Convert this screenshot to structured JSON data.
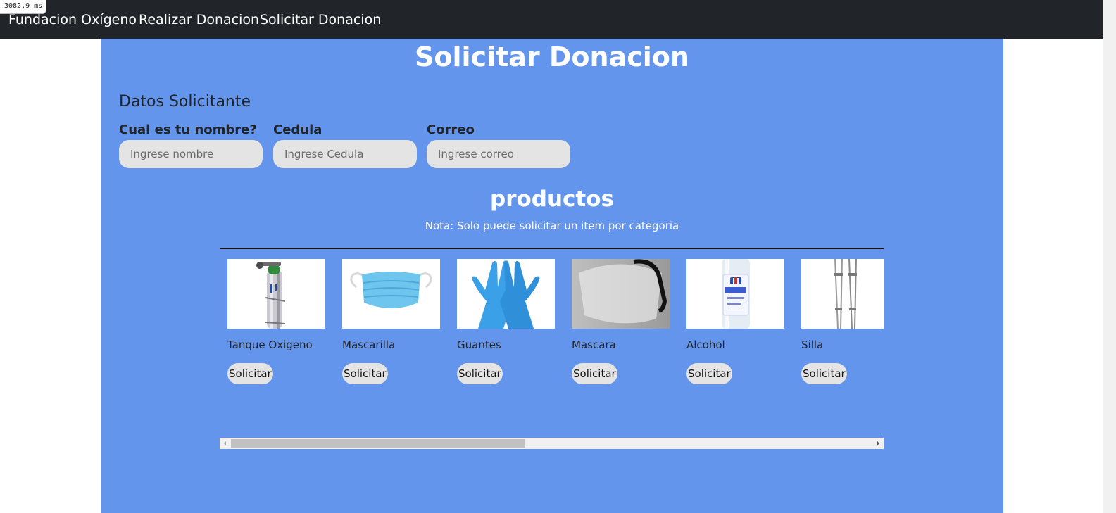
{
  "perf_badge": "3082.9 ms",
  "navbar": {
    "brand": "Fundacion Oxígeno",
    "links": [
      "Realizar Donacion",
      "Solicitar Donacion"
    ]
  },
  "page": {
    "title": "Solicitar Donacion",
    "section_title": "Datos Solicitante"
  },
  "form": {
    "name_label": "Cual es tu nombre?",
    "name_placeholder": "Ingrese nombre",
    "cedula_label": "Cedula",
    "cedula_placeholder": "Ingrese Cedula",
    "email_label": "Correo",
    "email_placeholder": "Ingrese correo"
  },
  "products": {
    "title": "productos",
    "note": "Nota: Solo puede solicitar un item por categoria",
    "request_label": "Solicitar",
    "items": [
      {
        "name": "Tanque Oxigeno",
        "icon": "oxygen-tank-image"
      },
      {
        "name": "Mascarilla",
        "icon": "face-mask-image"
      },
      {
        "name": "Guantes",
        "icon": "gloves-image"
      },
      {
        "name": "Mascara",
        "icon": "face-shield-image"
      },
      {
        "name": "Alcohol",
        "icon": "alcohol-bottle-image"
      },
      {
        "name": "Silla",
        "icon": "crutches-image"
      }
    ]
  },
  "colors": {
    "navbar_bg": "#212529",
    "main_bg": "#6495ed",
    "input_bg": "#e4e4e4"
  }
}
